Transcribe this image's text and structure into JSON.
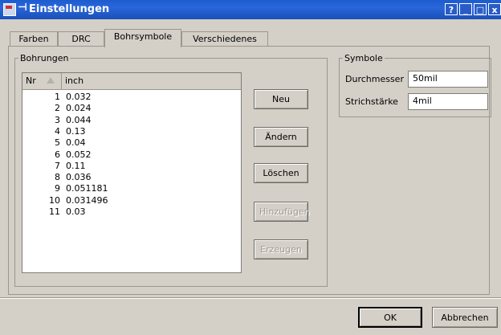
{
  "window": {
    "title": "Einstellungen",
    "help": "?",
    "minimize": "_",
    "maximize": "□",
    "close": "x"
  },
  "tabs": [
    {
      "label": "Farben"
    },
    {
      "label": "DRC"
    },
    {
      "label": "Bohrsymbole"
    },
    {
      "label": "Verschiedenes"
    }
  ],
  "bohrungen": {
    "legend": "Bohrungen",
    "columns": {
      "nr": "Nr",
      "value": "inch"
    },
    "rows": [
      {
        "nr": "1",
        "value": "0.032"
      },
      {
        "nr": "2",
        "value": "0.024"
      },
      {
        "nr": "3",
        "value": "0.044"
      },
      {
        "nr": "4",
        "value": "0.13"
      },
      {
        "nr": "5",
        "value": "0.04"
      },
      {
        "nr": "6",
        "value": "0.052"
      },
      {
        "nr": "7",
        "value": "0.11"
      },
      {
        "nr": "8",
        "value": "0.036"
      },
      {
        "nr": "9",
        "value": "0.051181"
      },
      {
        "nr": "10",
        "value": "0.031496"
      },
      {
        "nr": "11",
        "value": "0.03"
      }
    ],
    "buttons": {
      "neu": "Neu",
      "aendern": "Ändern",
      "loeschen": "Löschen",
      "hinzufuegen": "Hinzufügen",
      "erzeugen": "Erzeugen"
    }
  },
  "symbole": {
    "legend": "Symbole",
    "durchmesser_label": "Durchmesser",
    "durchmesser_value": "50mil",
    "strichstaerke_label": "Strichstärke",
    "strichstaerke_value": "4mil"
  },
  "footer": {
    "ok": "OK",
    "abbrechen": "Abbrechen"
  }
}
